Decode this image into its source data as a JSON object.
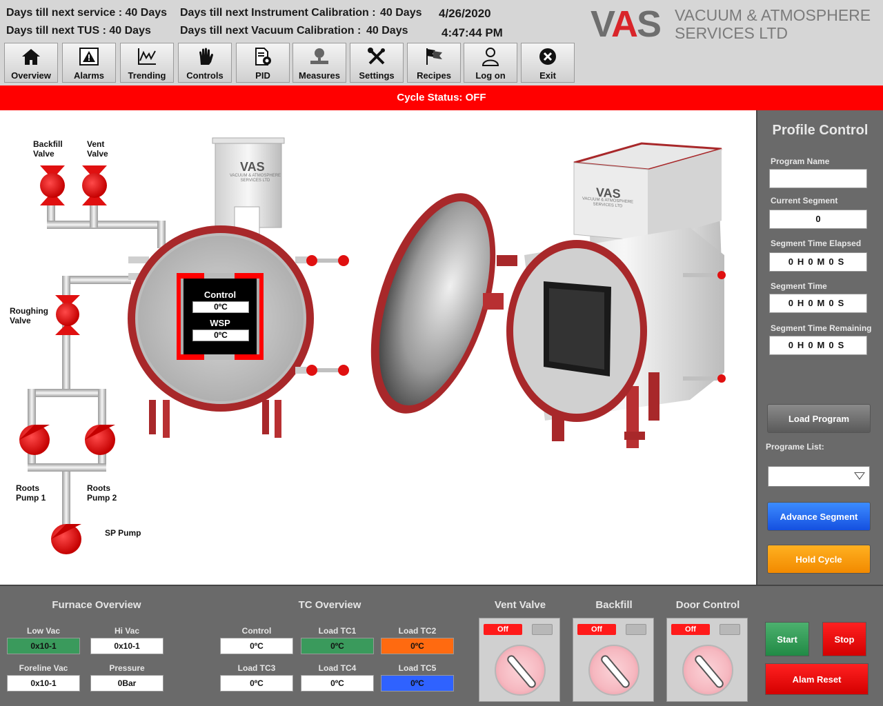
{
  "header": {
    "service_label": "Days till next service : 40 Days",
    "tus_label": "Days till next TUS : 40 Days",
    "instrument_cal_label": "Days till next Instrument Calibration :",
    "instrument_cal_value": "40 Days",
    "vacuum_cal_label": "Days till next Vacuum Calibration :",
    "vacuum_cal_value": "40 Days",
    "date": "4/26/2020",
    "time": "4:47:44 PM",
    "logo_text": "VAS",
    "company_line1": "VACUUM & ATMOSPHERE",
    "company_line2": "SERVICES LTD"
  },
  "nav": [
    {
      "label": "Overview",
      "icon": "home-icon"
    },
    {
      "label": "Alarms",
      "icon": "alarm-icon"
    },
    {
      "label": "Trending",
      "icon": "trend-chart-icon"
    },
    {
      "label": "Controls",
      "icon": "hand-icon"
    },
    {
      "label": "PID",
      "icon": "document-gear-icon"
    },
    {
      "label": "Measures",
      "icon": "gauge-icon"
    },
    {
      "label": "Settings",
      "icon": "wrench-screwdriver-icon"
    },
    {
      "label": "Recipes",
      "icon": "flags-icon"
    },
    {
      "label": "Log on",
      "icon": "user-icon"
    },
    {
      "label": "Exit",
      "icon": "close-circle-icon"
    }
  ],
  "status": {
    "text": "Cycle Status: OFF",
    "color": "#ff0000"
  },
  "diagram": {
    "backfill_valve": "Backfill\nValve",
    "vent_valve": "Vent\nValve",
    "roughing_valve": "Roughing\nValve",
    "roots_pump_1": "Roots\nPump 1",
    "roots_pump_2": "Roots\nPump 2",
    "sp_pump": "SP Pump",
    "furnace_logo": "VAS",
    "furnace_logo_sub": "VACUUM & ATMOSPHERE\nSERVICES LTD",
    "control_label": "Control",
    "control_value": "0ºC",
    "wsp_label": "WSP",
    "wsp_value": "0ºC"
  },
  "profile": {
    "title": "Profile Control",
    "program_name_label": "Program Name",
    "program_name_value": "",
    "current_segment_label": "Current Segment",
    "current_segment_value": "0",
    "seg_elapsed_label": "Segment Time Elapsed",
    "seg_elapsed_value": "0H0M0S",
    "seg_time_label": "Segment Time",
    "seg_time_value": "0H0M0S",
    "seg_remaining_label": "Segment Time Remaining",
    "seg_remaining_value": "0H0M0S",
    "load_program_button": "Load Program",
    "program_list_label": "Programe List:",
    "program_list_selected": "",
    "advance_segment_button": "Advance Segment",
    "hold_cycle_button": "Hold Cycle"
  },
  "furnace_overview": {
    "title": "Furnace Overview",
    "low_vac_label": "Low Vac",
    "low_vac_value": "0x10-1",
    "hi_vac_label": "Hi Vac",
    "hi_vac_value": "0x10-1",
    "foreline_vac_label": "Foreline Vac",
    "foreline_vac_value": "0x10-1",
    "pressure_label": "Pressure",
    "pressure_value": "0Bar"
  },
  "tc_overview": {
    "title": "TC Overview",
    "items": [
      {
        "label": "Control",
        "value": "0ºC",
        "color": "#ffffff"
      },
      {
        "label": "Load TC1",
        "value": "0ºC",
        "color": "#3a9a5c"
      },
      {
        "label": "Load TC2",
        "value": "0ºC",
        "color": "#ff6a10"
      },
      {
        "label": "Load TC3",
        "value": "0ºC",
        "color": "#ffffff"
      },
      {
        "label": "Load TC4",
        "value": "0ºC",
        "color": "#ffffff"
      },
      {
        "label": "Load TC5",
        "value": "0ºC",
        "color": "#2f62ff"
      }
    ]
  },
  "valve_controls": [
    {
      "title": "Vent Valve",
      "state": "Off"
    },
    {
      "title": "Backfill",
      "state": "Off"
    },
    {
      "title": "Door Control",
      "state": "Off"
    }
  ],
  "actions": {
    "start_button": "Start",
    "stop_button": "Stop",
    "alarm_reset_button": "Alam Reset"
  },
  "colors": {
    "accent_red": "#ff0000",
    "panel_grey": "#6a6a6a",
    "furnace_red": "#a8282a"
  }
}
